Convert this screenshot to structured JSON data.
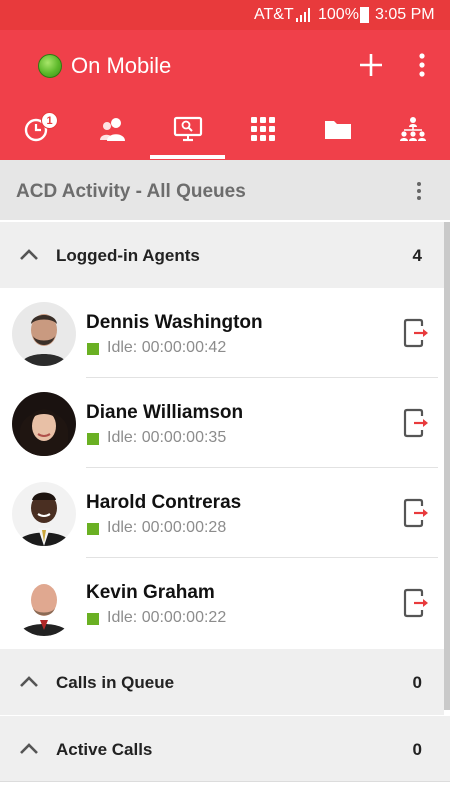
{
  "status_bar": {
    "carrier": "AT&T",
    "battery": "100%",
    "time": "3:05 PM"
  },
  "header": {
    "presence": "On Mobile",
    "presence_color": "#5cb82a",
    "accent_color": "#f0404a",
    "actions": [
      "add-icon",
      "more-vert-icon"
    ]
  },
  "tabs": [
    {
      "icon": "history-icon",
      "badge": "1"
    },
    {
      "icon": "contacts-icon"
    },
    {
      "icon": "acd-monitor-icon",
      "selected": true
    },
    {
      "icon": "dialpad-icon"
    },
    {
      "icon": "folder-icon"
    },
    {
      "icon": "org-chart-icon"
    }
  ],
  "page": {
    "title": "ACD Activity - All Queues"
  },
  "sections": {
    "logged_in": {
      "label": "Logged-in Agents",
      "count": "4"
    },
    "calls_in_queue": {
      "label": "Calls in Queue",
      "count": "0"
    },
    "active_calls": {
      "label": "Active Calls",
      "count": "0"
    }
  },
  "agents": [
    {
      "name": "Dennis Washington",
      "status": "Idle: 00:00:00:42"
    },
    {
      "name": "Diane Williamson",
      "status": "Idle: 00:00:00:35"
    },
    {
      "name": "Harold Contreras",
      "status": "Idle: 00:00:00:28"
    },
    {
      "name": "Kevin Graham",
      "status": "Idle: 00:00:00:22"
    }
  ],
  "status_color": "#6ab023"
}
